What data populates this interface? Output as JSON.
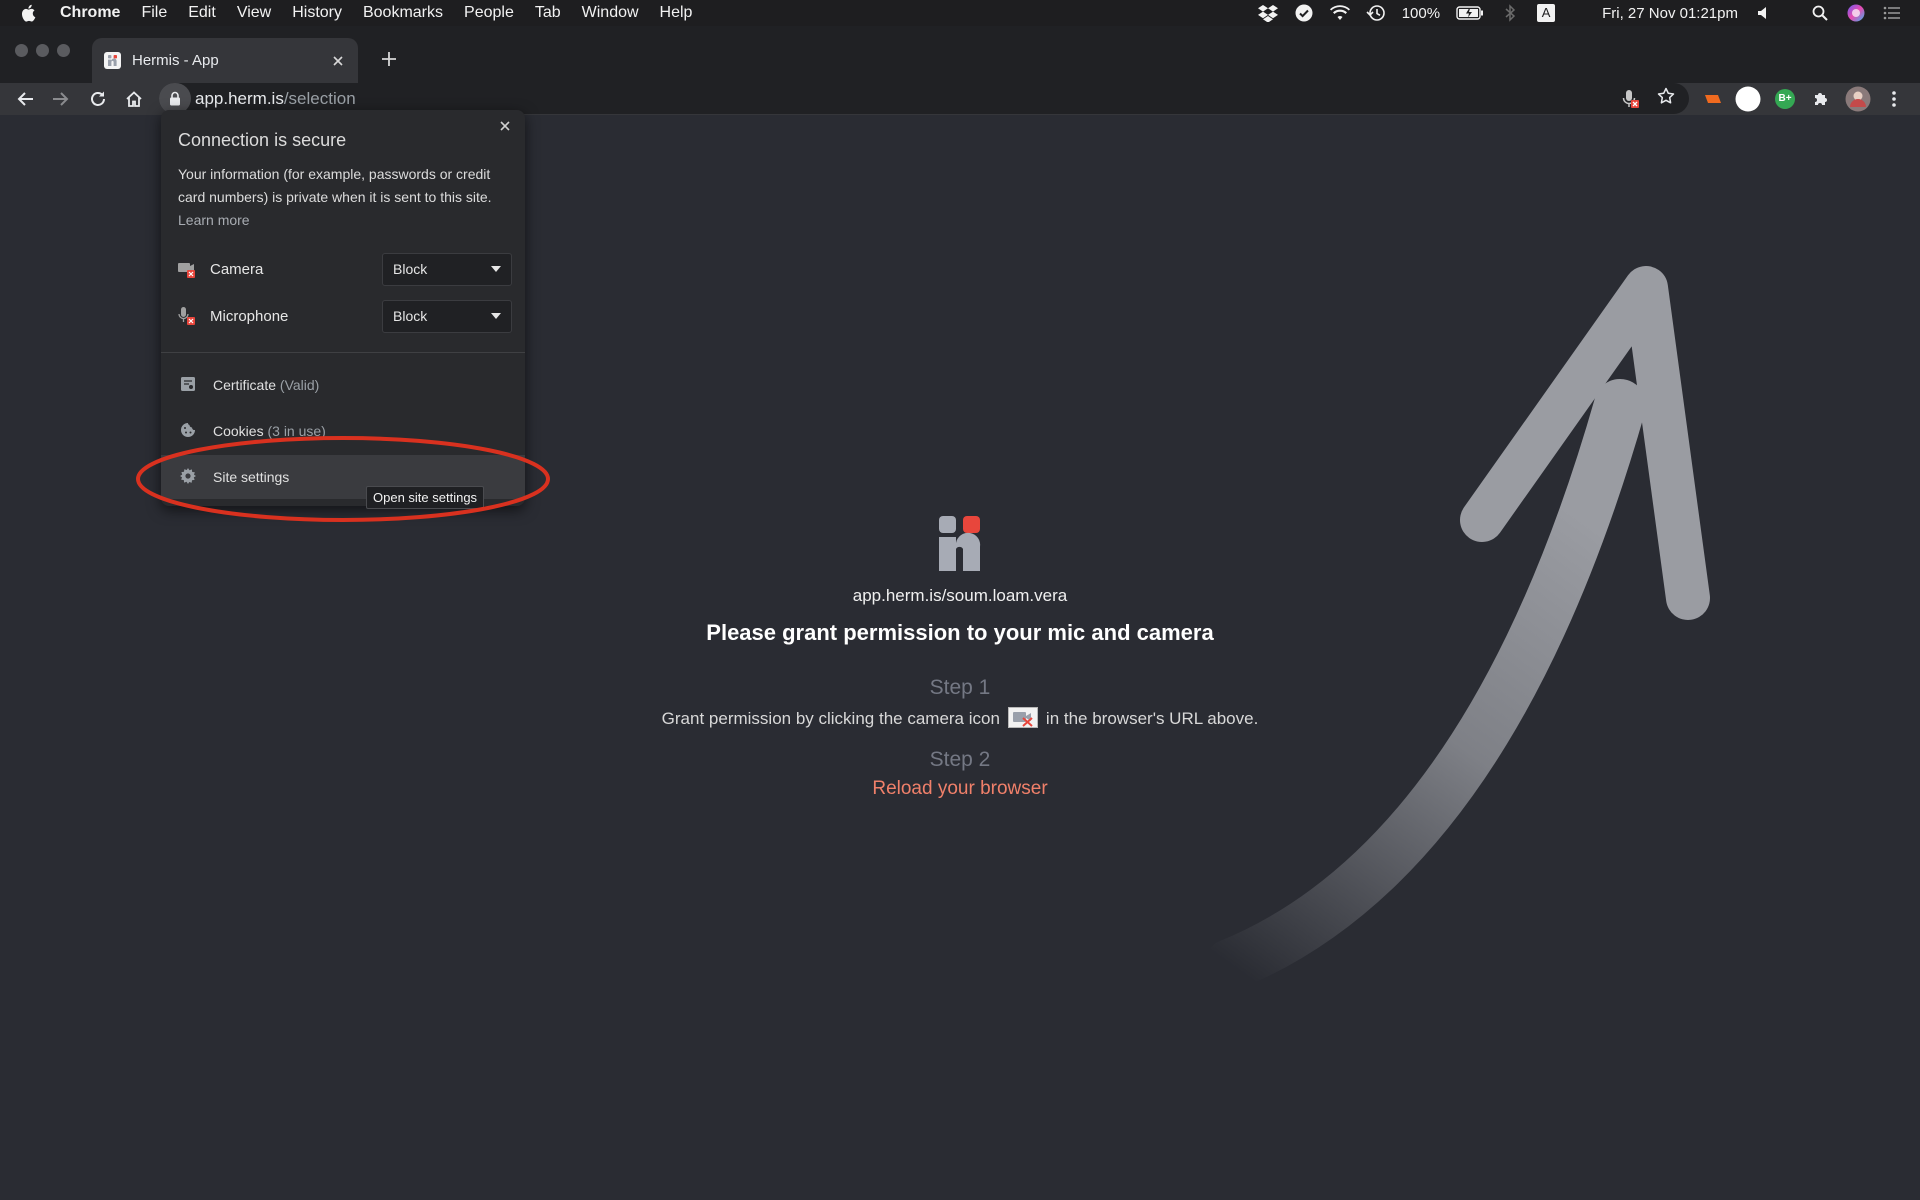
{
  "menubar": {
    "items": [
      "Chrome",
      "File",
      "Edit",
      "View",
      "History",
      "Bookmarks",
      "People",
      "Tab",
      "Window",
      "Help"
    ],
    "battery": "100%",
    "input_source": "A",
    "clock": "Fri, 27 Nov  01:21pm"
  },
  "browser": {
    "tab_title": "Hermis - App",
    "url_host": "app.herm.is",
    "url_path": "/selection",
    "ext_badge": "B+"
  },
  "popover": {
    "title": "Connection is secure",
    "description": "Your information (for example, passwords or credit card numbers) is private when it is sent to this site.",
    "learn_more": "Learn more",
    "permissions": [
      {
        "label": "Camera",
        "value": "Block"
      },
      {
        "label": "Microphone",
        "value": "Block"
      }
    ],
    "certificate": {
      "label": "Certificate",
      "status": "(Valid)"
    },
    "cookies": {
      "label": "Cookies",
      "status": "(3 in use)"
    },
    "site_settings": {
      "label": "Site settings",
      "tooltip": "Open site settings"
    }
  },
  "page": {
    "room_url": "app.herm.is/soum.loam.vera",
    "heading": "Please grant permission to your mic and camera",
    "step1_label": "Step 1",
    "step1_text_before": "Grant permission by clicking the camera icon",
    "step1_text_after": "in the browser's URL above.",
    "step2_label": "Step 2",
    "step2_link": "Reload your browser"
  },
  "colors": {
    "accent_red": "#e8463c",
    "link_salmon": "#f0806a",
    "background": "#2a2c33"
  }
}
